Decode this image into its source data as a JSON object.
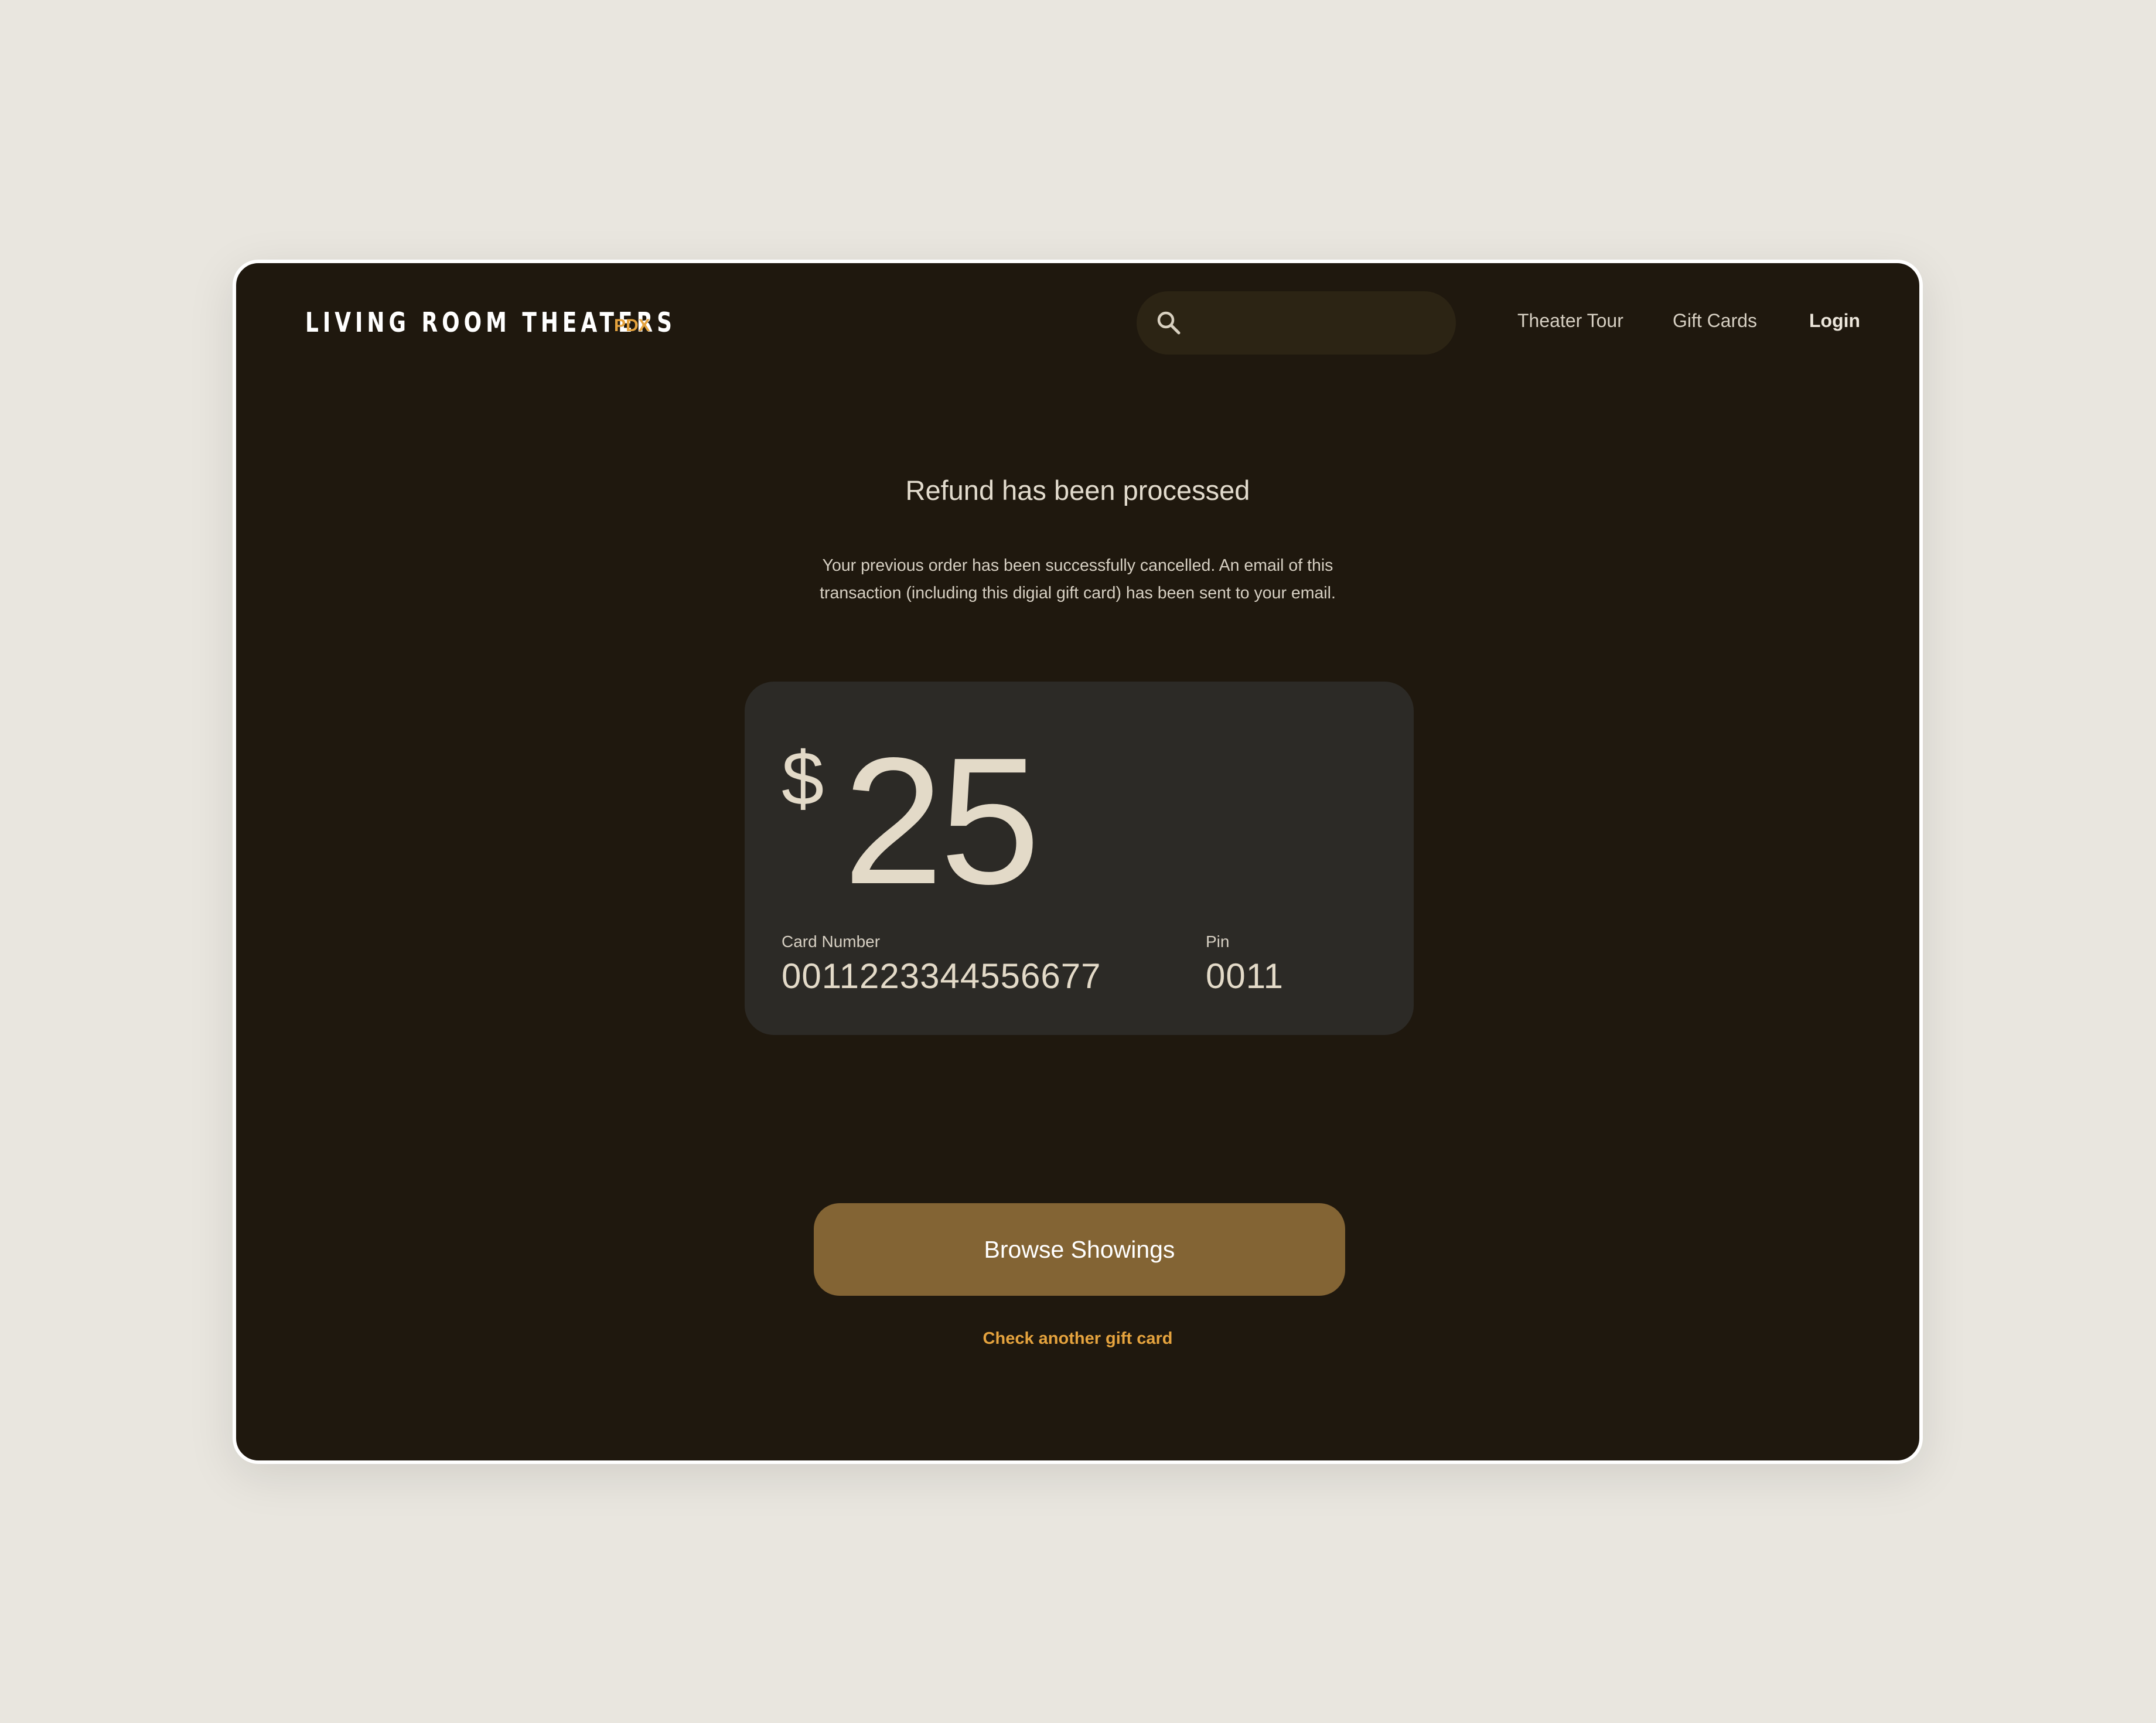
{
  "header": {
    "brand_name": "LIVING ROOM THEATERS",
    "brand_sub": "PDX",
    "search": {
      "placeholder": "",
      "value": "",
      "icon": "search-icon"
    },
    "nav": {
      "theater_tour": "Theater Tour",
      "gift_cards": "Gift Cards",
      "login": "Login"
    }
  },
  "main": {
    "title": "Refund has been processed",
    "description_line1": "Your previous order has been successfully cancelled. An email of this",
    "description_line2": "transaction (including this digial gift card) has been sent to your email.",
    "gift_card": {
      "currency_symbol": "$",
      "amount": "25",
      "card_number_label": "Card Number",
      "card_number": "0011223344556677",
      "pin_label": "Pin",
      "pin": "0011"
    },
    "browse_button": "Browse Showings",
    "check_link": "Check another gift card"
  },
  "colors": {
    "page_background": "#e9e6df",
    "app_background": "#1f180e",
    "card_background": "#2c2a26",
    "accent": "#e5a33e",
    "button": "#836434"
  }
}
